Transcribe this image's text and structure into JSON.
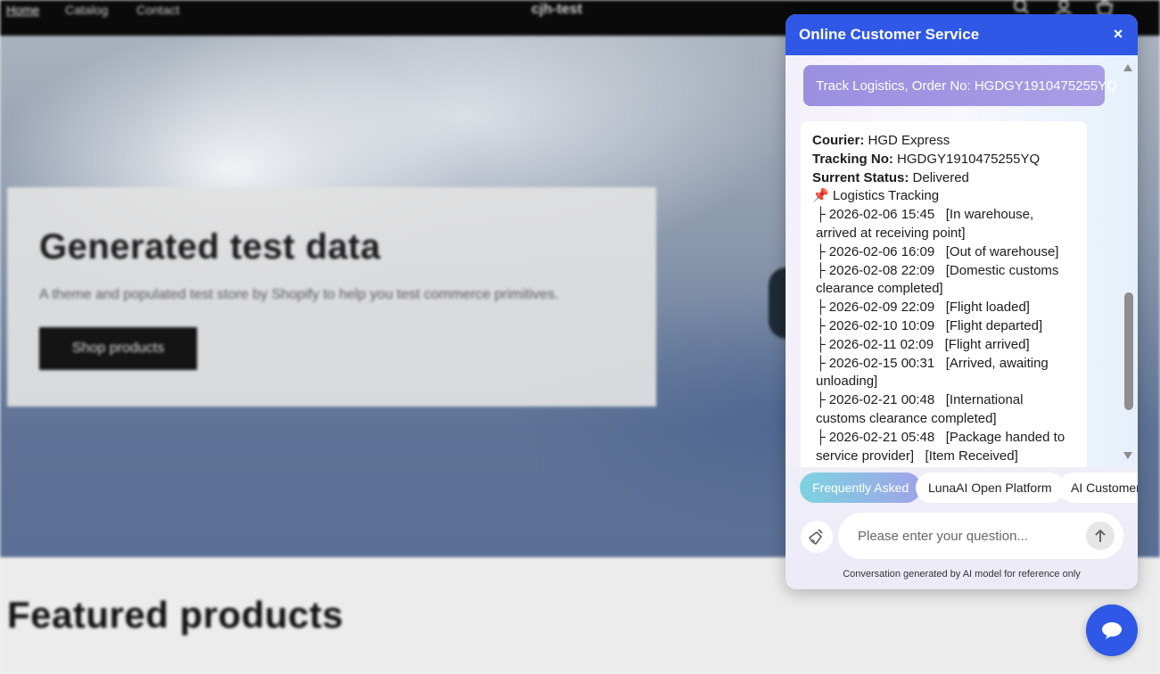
{
  "store": {
    "nav": {
      "links": [
        "Home",
        "Catalog",
        "Contact"
      ],
      "brand": "cjh-test",
      "icons": [
        "search-icon",
        "account-icon",
        "cart-icon"
      ]
    },
    "hero": {
      "title": "Generated test data",
      "subtitle": "A theme and populated test store by Shopify to help you test commerce primitives.",
      "button": "Shop products"
    },
    "featured_title": "Featured products"
  },
  "chat": {
    "title": "Online Customer Service",
    "close_icon": "×",
    "user_message": "Track Logistics, Order No: HGDGY1910475255YQ",
    "bot_message": {
      "courier_label": "Courier:",
      "courier": "HGD Express",
      "tracking_label": "Tracking No:",
      "tracking": "HGDGY1910475255YQ",
      "status_label": "Surrent Status:",
      "status": "Delivered",
      "tracking_header": "📌 Logistics Tracking",
      "events": [
        "├ 2026-02-06 15:45   [In warehouse, arrived at receiving point]",
        "├ 2026-02-06 16:09   [Out of warehouse]",
        "├ 2026-02-08 22:09   [Domestic customs clearance completed]",
        "├ 2026-02-09 22:09   [Flight loaded]",
        "├ 2026-02-10 10:09   [Flight departed]",
        "├ 2026-02-11 02:09   [Flight arrived]",
        "├ 2026-02-15 00:31   [Arrived, awaiting unloading]",
        "├ 2026-02-21 00:48   [International customs clearance completed]",
        "├ 2026-02-21 05:48   [Package handed to service provider]   [Item Received]"
      ]
    },
    "quick_replies": [
      "Frequently Asked",
      "LunaAI Open Platform",
      "AI Customer Service"
    ],
    "input_placeholder": "Please enter your question...",
    "disclaimer": "Conversation generated by AI model for reference only"
  },
  "colors": {
    "accent": "#2f58e6",
    "user_bubble": "#a297e3",
    "chip_active": "#8fbde6"
  }
}
